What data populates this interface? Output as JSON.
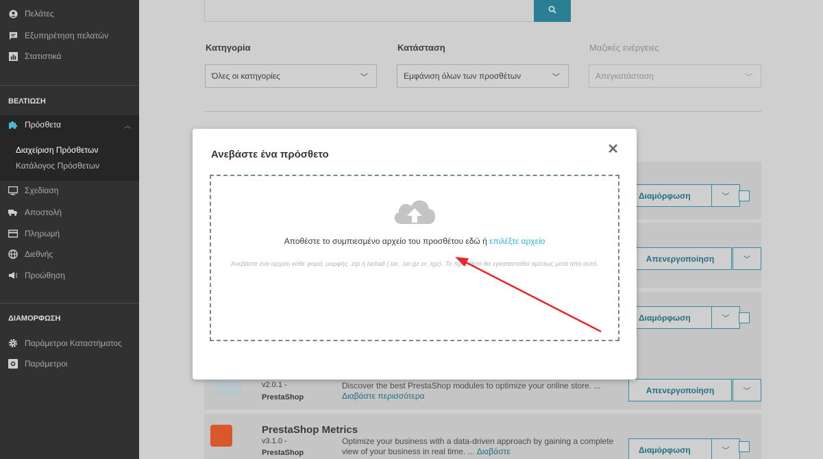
{
  "sidebar": {
    "items_top": [
      {
        "label": "Πελάτες",
        "icon": "user-circle-icon"
      },
      {
        "label": "Εξυπηρέτηση πελατών",
        "icon": "chat-icon"
      },
      {
        "label": "Στατιστικά",
        "icon": "bar-chart-icon"
      }
    ],
    "section_improve": "ΒΕΛΤΙΩΣΗ",
    "active_item": {
      "label": "Πρόσθετα",
      "icon": "puzzle-icon"
    },
    "sub_items": [
      "Διαχείριση Πρόσθετων",
      "Κατάλογος Πρόσθετων"
    ],
    "items_mid": [
      {
        "label": "Σχεδίαση",
        "icon": "monitor-icon"
      },
      {
        "label": "Αποστολή",
        "icon": "truck-icon"
      },
      {
        "label": "Πληρωμή",
        "icon": "credit-card-icon"
      },
      {
        "label": "Διεθνής",
        "icon": "globe-icon"
      },
      {
        "label": "Προώθηση",
        "icon": "megaphone-icon"
      }
    ],
    "section_config": "ΔΙΑΜΟΡΦΩΣΗ",
    "items_bottom": [
      {
        "label": "Παράμετροι Καταστήματος",
        "icon": "gear-icon"
      },
      {
        "label": "Παράμετροι",
        "icon": "settings-box-icon"
      }
    ]
  },
  "filters": {
    "category_label": "Κατηγορία",
    "category_value": "Όλες οι κατηγορίες",
    "status_label": "Κατάσταση",
    "status_value": "Εμφάνιση όλων των προσθέτων",
    "bulk_label": "Μαζικές ενέργειες",
    "bulk_value": "Απεγκατάσταση"
  },
  "modules": [
    {
      "button": "Διαμόρφωση"
    },
    {
      "button": "Απενεργοποίηση"
    },
    {
      "button": "Διαμόρφωση"
    },
    {
      "version": "v2.0.1 -",
      "author": "PrestaShop",
      "desc": "Discover the best PrestaShop modules to optimize your online store. ... ",
      "more": "Διαβάστε περισσότερα",
      "button": "Απενεργοποίηση"
    },
    {
      "title": "PrestaShop Metrics",
      "version": "v3.1.0 -",
      "author": "PrestaShop",
      "desc": "Optimize your business with a data-driven approach by gaining a complete view of your business in real time. ... ",
      "more": "Διαβάστε",
      "button": "Διαμόρφωση"
    }
  ],
  "modal": {
    "title": "Ανεβάστε ένα πρόσθετο",
    "close": "✕",
    "drop_text": "Αποθέστε το συμπιεσμένο αρχείο του προσθέτου εδώ ή ",
    "drop_link": "επιλέξτε αρχείο",
    "hint": "Ανεβάστε ένα αρχείο κάθε φορά, μορφής .zip ή tarball (.tar, .tar.gz or .tgz). Το πρόσθετο θα εγκατασταθεί αμέσως μετά από αυτό."
  },
  "colors": {
    "accent": "#25b9d7",
    "annotation_arrow": "#e8262b"
  }
}
